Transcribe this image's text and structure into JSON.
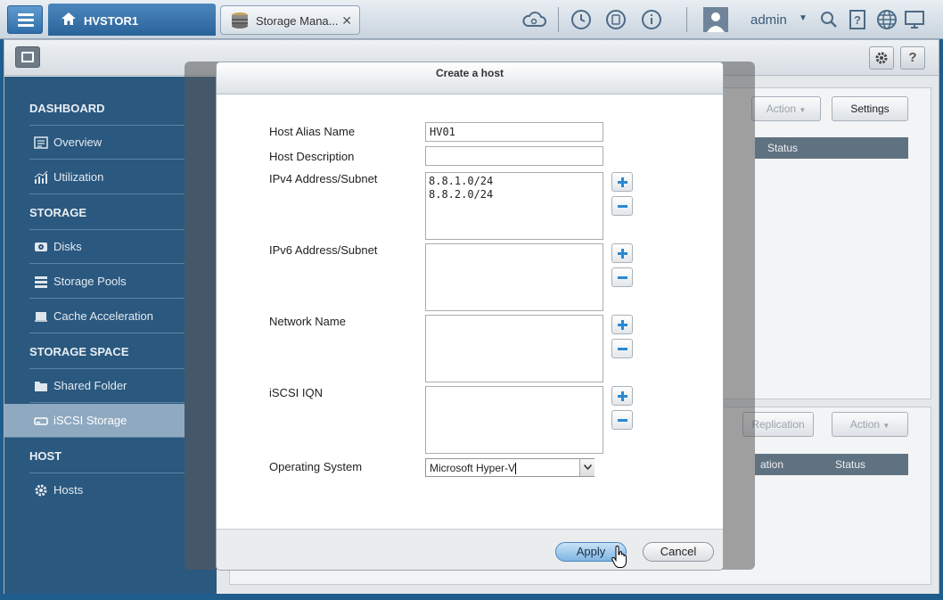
{
  "topbar": {
    "nas_name": "HVSTOR1",
    "app_tab_label": "Storage Mana...",
    "user": "admin"
  },
  "toolbar": {
    "help_label": "?"
  },
  "sidebar": {
    "sections": [
      {
        "label": "DASHBOARD"
      },
      {
        "label": "STORAGE"
      },
      {
        "label": "STORAGE SPACE"
      },
      {
        "label": "HOST"
      }
    ],
    "items": [
      {
        "label": "Overview",
        "icon": "overview-icon"
      },
      {
        "label": "Utilization",
        "icon": "chart-icon"
      },
      {
        "label": "Disks",
        "icon": "disk-icon"
      },
      {
        "label": "Storage Pools",
        "icon": "pool-icon"
      },
      {
        "label": "Cache Acceleration",
        "icon": "cache-icon"
      },
      {
        "label": "Shared Folder",
        "icon": "folder-icon"
      },
      {
        "label": "iSCSI Storage",
        "icon": "iscsi-icon"
      },
      {
        "label": "Hosts",
        "icon": "gear-icon"
      }
    ]
  },
  "background": {
    "top_action": "Action",
    "settings": "Settings",
    "top_status": "Status",
    "replication": "Replication",
    "bottom_action": "Action",
    "bottom_col_partial": "ation",
    "bottom_status": "Status"
  },
  "dialog": {
    "title": "Create a host",
    "fields": {
      "alias_label": "Host Alias Name",
      "alias_value": "HV01",
      "description_label": "Host Description",
      "description_value": "",
      "ipv4_label": "IPv4 Address/Subnet",
      "ipv4_values": [
        "8.8.1.0/24",
        "8.8.2.0/24"
      ],
      "ipv6_label": "IPv6 Address/Subnet",
      "network_label": "Network Name",
      "iqn_label": "iSCSI IQN",
      "os_label": "Operating System",
      "os_value": "Microsoft Hyper-V"
    },
    "apply": "Apply",
    "cancel": "Cancel"
  },
  "colors": {
    "sidebar_bg": "#2a587f",
    "accent_blue": "#2d88cf",
    "apply_button": "#7fb5e4"
  }
}
